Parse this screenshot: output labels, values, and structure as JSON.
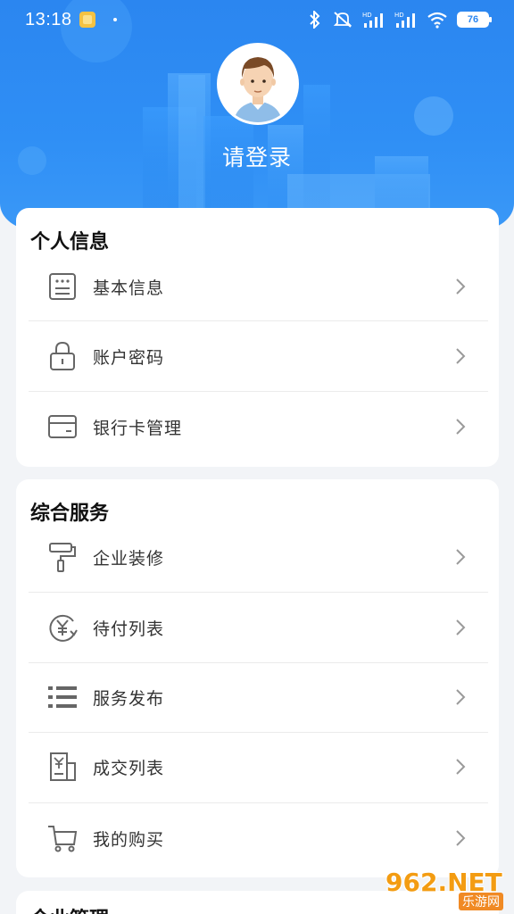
{
  "status_bar": {
    "time": "13:18",
    "battery": "76",
    "icons": [
      "notification-icon",
      "bluetooth-icon",
      "mute-icon",
      "signal-hd-icon",
      "signal-hd-icon",
      "wifi-icon",
      "battery-icon"
    ]
  },
  "profile": {
    "login_label": "请登录",
    "avatar_icon": "avatar-icon"
  },
  "personal_info": {
    "title": "个人信息",
    "items": [
      {
        "label": "基本信息",
        "icon": "id-card-icon"
      },
      {
        "label": "账户密码",
        "icon": "lock-icon"
      },
      {
        "label": "银行卡管理",
        "icon": "bank-card-icon"
      }
    ]
  },
  "services": {
    "title": "综合服务",
    "items": [
      {
        "label": "企业装修",
        "icon": "paint-roller-icon"
      },
      {
        "label": "待付列表",
        "icon": "yuan-cycle-icon"
      },
      {
        "label": "服务发布",
        "icon": "list-icon"
      },
      {
        "label": "成交列表",
        "icon": "receipt-icon"
      },
      {
        "label": "我的购买",
        "icon": "cart-icon"
      }
    ]
  },
  "next_section": {
    "title": "企业管理"
  },
  "watermark": {
    "brand": "962.NET",
    "sub": "乐游网"
  },
  "colors": {
    "header_blue": "#2b86f0",
    "card_bg": "#ffffff",
    "page_bg": "#f2f4f7",
    "icon_gray": "#666666",
    "chevron_gray": "#9a9a9a"
  }
}
